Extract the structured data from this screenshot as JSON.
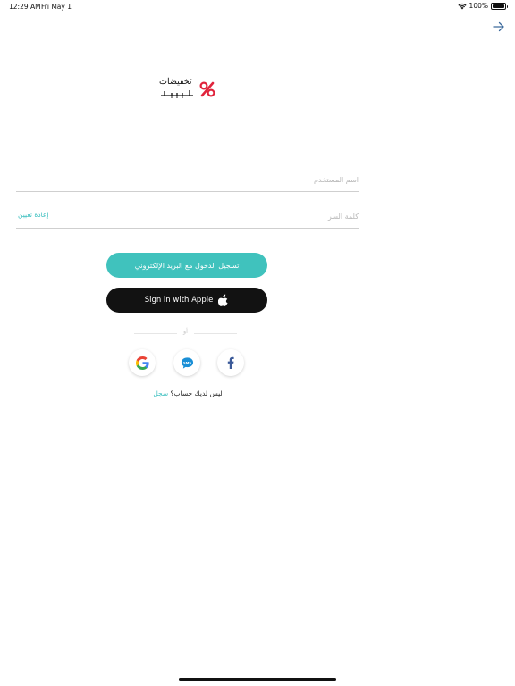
{
  "status_bar": {
    "time": "12:29 AM",
    "date": "Fri May 1",
    "battery": "100%",
    "battery_level": 1.0
  },
  "logo": {
    "wordmark_line1": "تخفيضات",
    "wordmark_line2": "ليبيا",
    "brand_color": "#e0243c"
  },
  "form": {
    "username_placeholder": "اسم المستخدم",
    "password_placeholder": "كلمة السر",
    "reset_link": "إعادة تعيين"
  },
  "buttons": {
    "email_login": "تسجيل الدخول مع البريد الإلكتروني",
    "apple_login": "Sign in with Apple"
  },
  "divider_text": "أو",
  "social": [
    {
      "name": "google-icon"
    },
    {
      "name": "sms-icon"
    },
    {
      "name": "facebook-icon"
    }
  ],
  "signup": {
    "prompt": "ليس لديك حساب؟",
    "link": "سجل"
  },
  "colors": {
    "accent": "#40c2bd",
    "apple_button": "#121212",
    "facebook": "#3b5a99",
    "google": "#e94235",
    "sms": "#1a8fd6"
  }
}
